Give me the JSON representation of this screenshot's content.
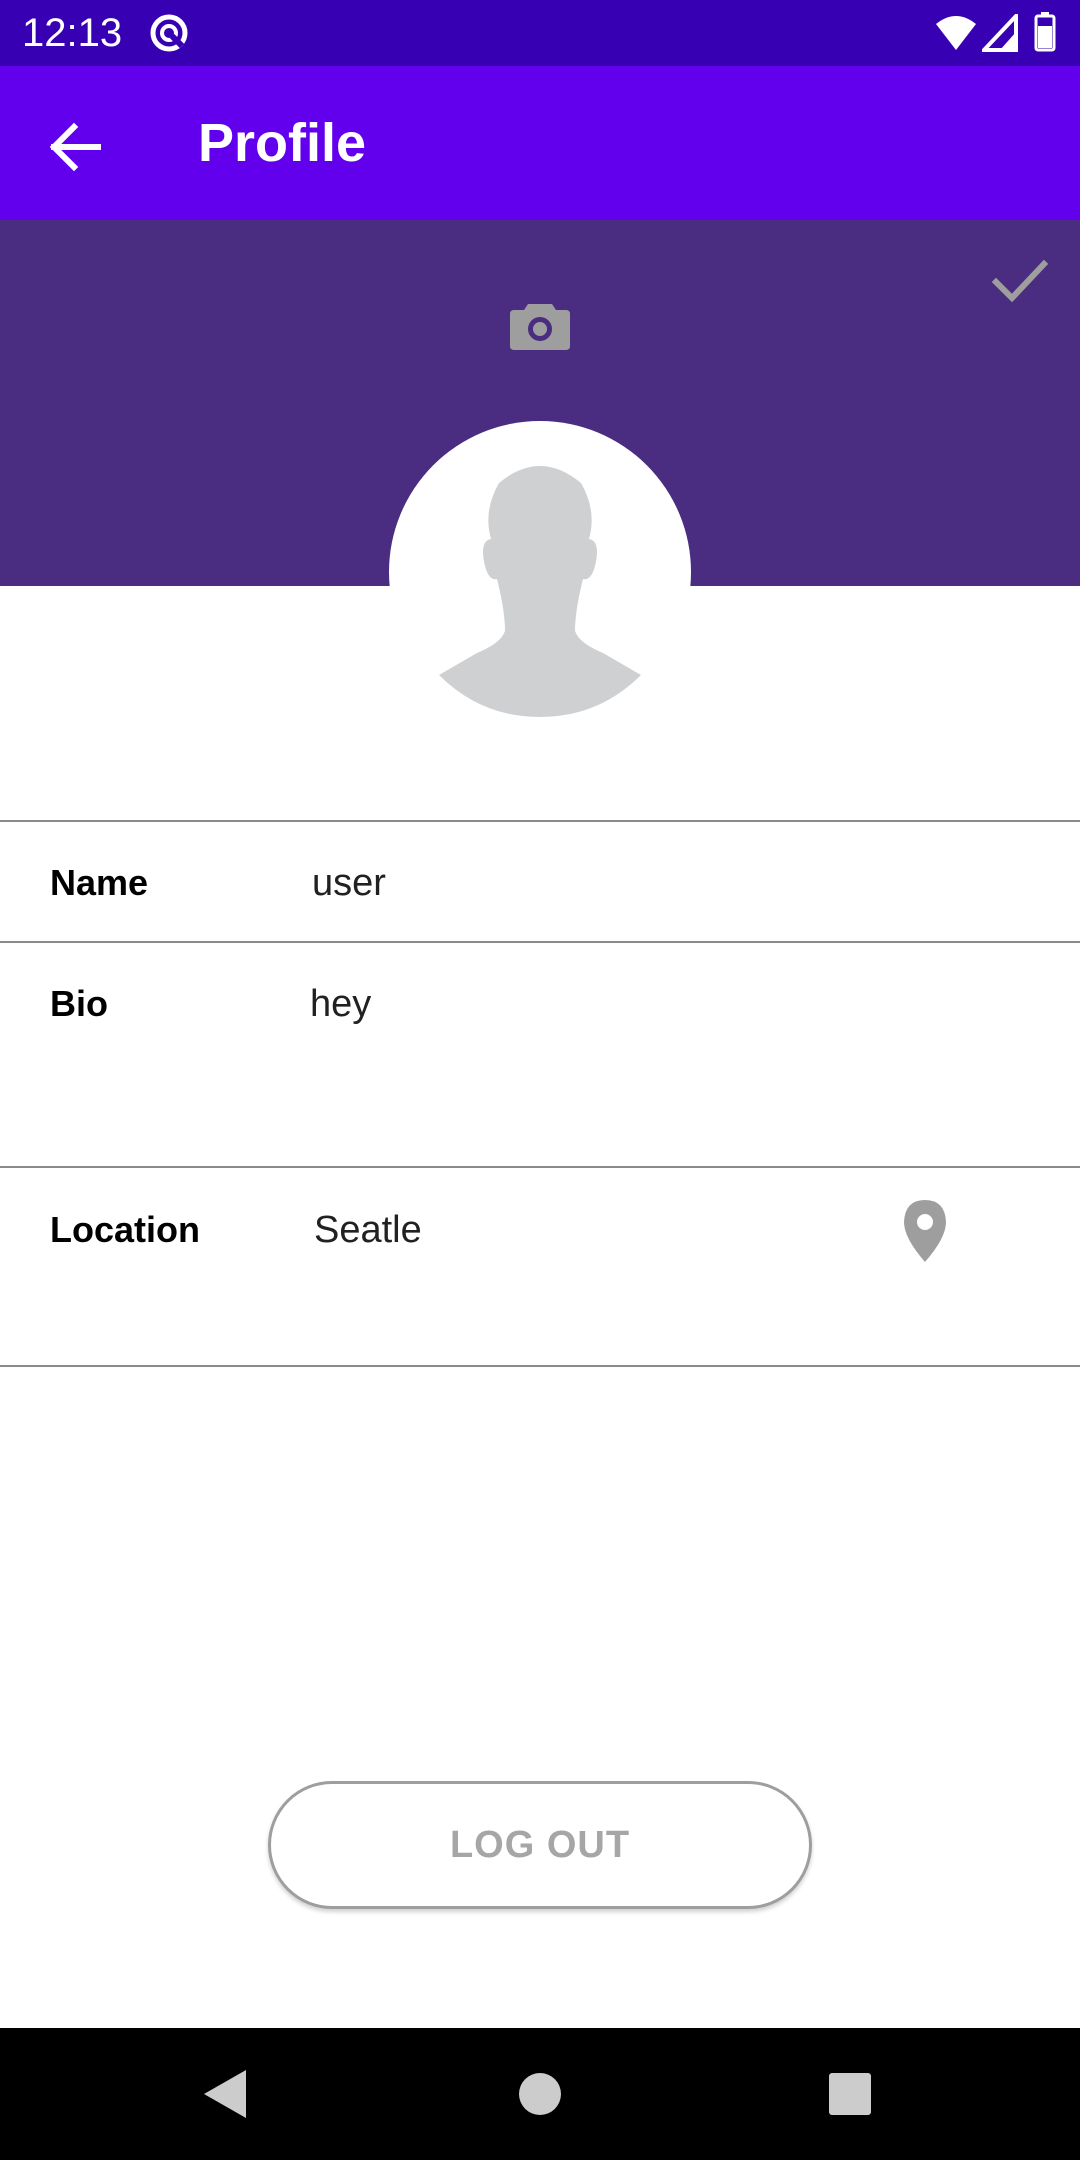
{
  "status_bar": {
    "time": "12:13",
    "icons": [
      "data-saver-icon",
      "wifi-icon",
      "cell-signal-icon",
      "battery-icon"
    ]
  },
  "app_bar": {
    "title": "Profile",
    "back_icon": "arrow-back-icon"
  },
  "header": {
    "save_icon": "check-icon",
    "camera_icon": "camera-icon",
    "avatar_icon": "person-silhouette-icon"
  },
  "fields": {
    "name": {
      "label": "Name",
      "value": "user"
    },
    "bio": {
      "label": "Bio",
      "value": "hey"
    },
    "location": {
      "label": "Location",
      "value": "Seatle",
      "icon": "map-pin-icon"
    }
  },
  "actions": {
    "logout_label": "LOG OUT"
  },
  "nav_bar": {
    "icons": [
      "nav-back-icon",
      "nav-home-icon",
      "nav-recents-icon"
    ]
  },
  "colors": {
    "status_bar": "#3700b3",
    "app_bar": "#6200ee",
    "header": "#4a2d80",
    "icon_grey": "#9e9e9e",
    "avatar_grey": "#cfd0d2"
  }
}
